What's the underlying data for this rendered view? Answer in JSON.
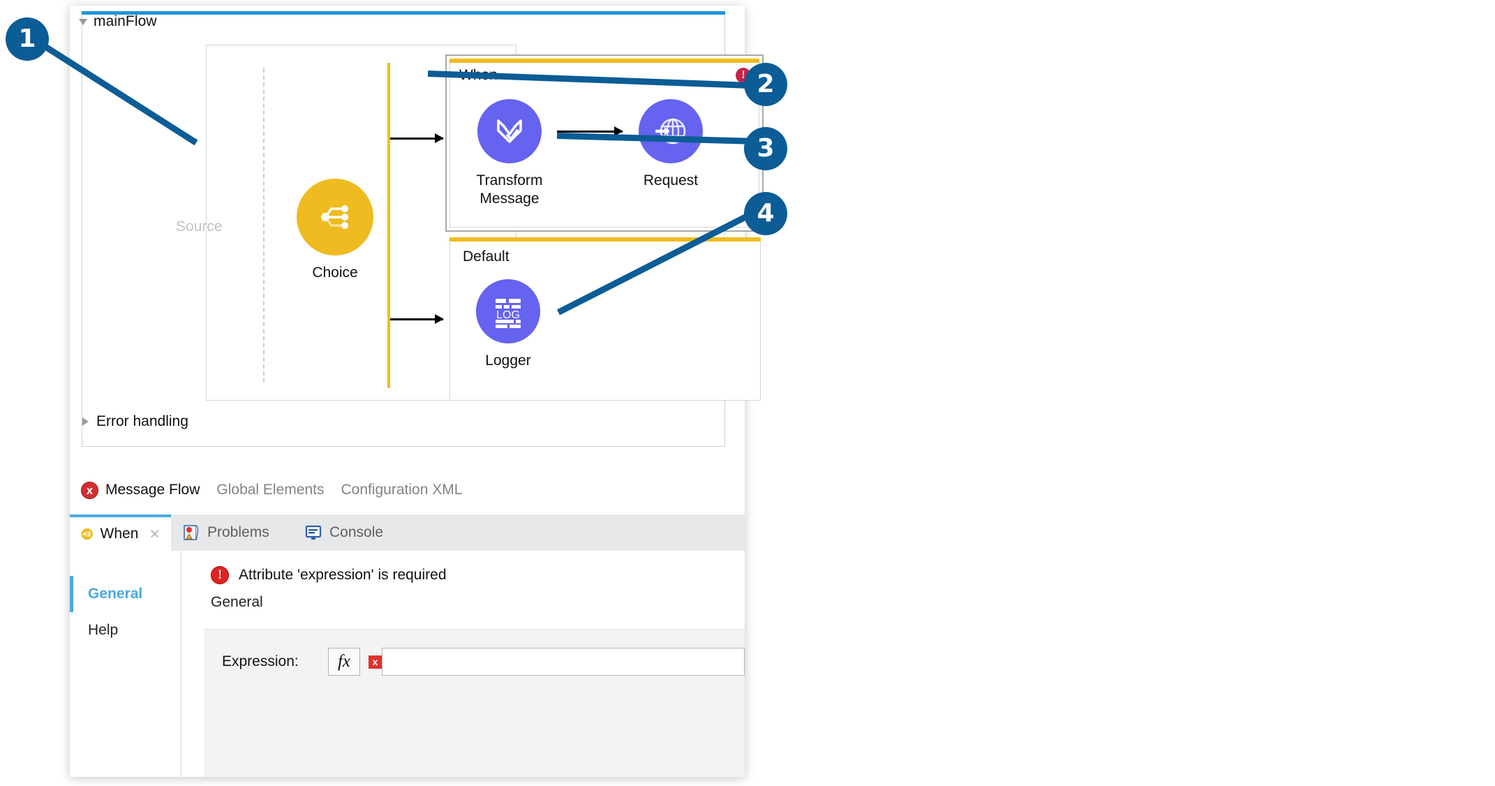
{
  "flow": {
    "name": "mainFlow",
    "expand_icon": "triangle-down-icon",
    "source_label": "Source",
    "error_handling_label": "Error handling",
    "error_handling_icon": "triangle-right-icon",
    "scopes": [
      {
        "caption": "When",
        "error_badge": "!",
        "error_badge_icon": "error-exclamation-icon"
      },
      {
        "caption": "Default"
      }
    ],
    "nodes": {
      "choice": {
        "label": "Choice",
        "icon": "choice-router-icon",
        "color": "#efbb20"
      },
      "transform": {
        "label_line1": "Transform",
        "label_line2": "Message",
        "icon": "dataweave-transform-icon",
        "color": "#6563ef"
      },
      "request": {
        "label": "Request",
        "icon": "http-request-globe-icon",
        "color": "#6563ef"
      },
      "logger": {
        "label": "Logger",
        "icon": "logger-log-icon",
        "color": "#6563ef"
      }
    }
  },
  "editor_tabs": [
    {
      "label": "Message Flow",
      "state": "active",
      "badge": "x",
      "badge_icon": "error-x-icon"
    },
    {
      "label": "Global Elements",
      "state": "idle"
    },
    {
      "label": "Configuration XML",
      "state": "idle"
    }
  ],
  "view_tabs": [
    {
      "label": "When",
      "state": "selected",
      "icon": "choice-router-icon",
      "close": "×"
    },
    {
      "label": "Problems",
      "state": "unselected",
      "icon": "problems-icon"
    },
    {
      "label": "Console",
      "state": "unselected",
      "icon": "console-monitor-icon"
    }
  ],
  "properties": {
    "nav": [
      {
        "label": "General",
        "state": "active"
      },
      {
        "label": "Help",
        "state": "idle"
      }
    ],
    "error_message": "Attribute 'expression' is required",
    "error_icon": "error-exclamation-icon",
    "section_title": "General",
    "fields": [
      {
        "label": "Expression:",
        "fx_button": "fx",
        "error_marker": "x",
        "value": "",
        "placeholder": ""
      }
    ]
  },
  "callouts": [
    {
      "number": "1"
    },
    {
      "number": "2"
    },
    {
      "number": "3"
    },
    {
      "number": "4"
    }
  ],
  "colors": {
    "accent_blue": "#1f94d4",
    "callout_blue": "#0c5c96",
    "router_yellow": "#efbb20",
    "node_purple": "#6563ef",
    "error_red": "#c9234a"
  }
}
